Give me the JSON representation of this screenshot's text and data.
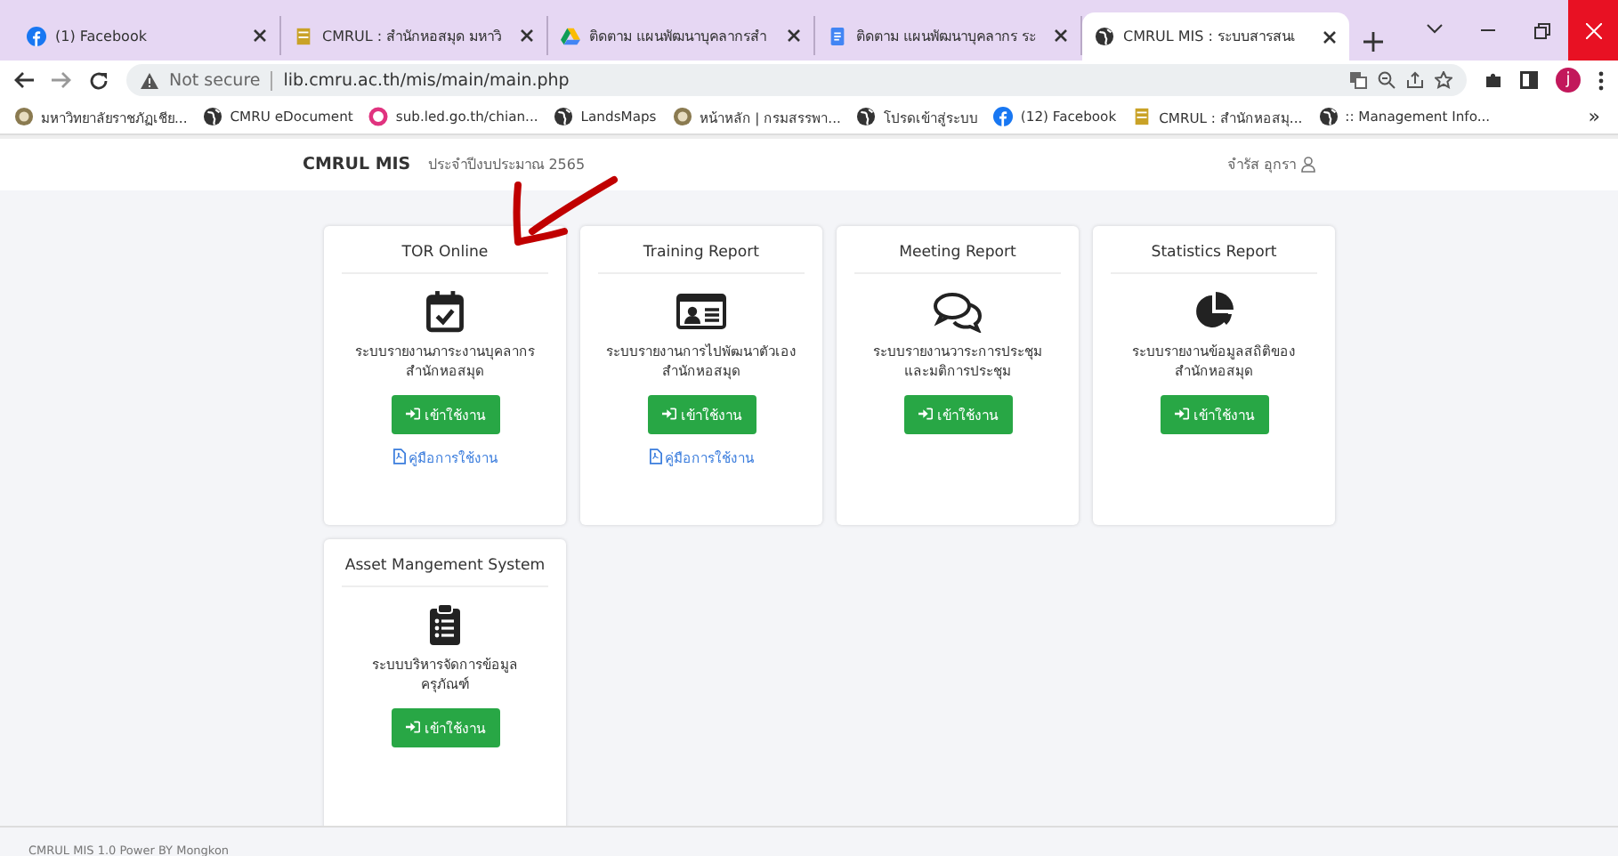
{
  "browser": {
    "tabs": [
      {
        "title": "(1) Facebook",
        "kind": "facebook",
        "selected": false
      },
      {
        "title": "CMRUL : สำนักหอสมุด มหาวิ",
        "kind": "book",
        "selected": false
      },
      {
        "title": "ติดตาม แผนพัฒนาบุคลากรสำ",
        "kind": "drive",
        "selected": false
      },
      {
        "title": "ติดตาม แผนพัฒนาบุคลากร ระ",
        "kind": "docs",
        "selected": false
      },
      {
        "title": "CMRUL MIS : ระบบสารสนเ",
        "kind": "globe",
        "selected": true
      }
    ],
    "security": "Not secure",
    "url": "lib.cmru.ac.th/mis/main/main.php",
    "avatar": "j",
    "bookmarks": [
      {
        "title": "มหาวิทยาลัยราชภัฏเชีย...",
        "kind": "seal"
      },
      {
        "title": "CMRU eDocument",
        "kind": "globe"
      },
      {
        "title": "sub.led.go.th/chian...",
        "kind": "pink"
      },
      {
        "title": "LandsMaps",
        "kind": "globe"
      },
      {
        "title": "หน้าหลัก | กรมสรรพา...",
        "kind": "seal"
      },
      {
        "title": "โปรดเข้าสู่ระบบ",
        "kind": "globe"
      },
      {
        "title": "(12) Facebook",
        "kind": "facebook"
      },
      {
        "title": "CMRUL : สำนักหอสมุ...",
        "kind": "book"
      },
      {
        "title": ":: Management Info...",
        "kind": "globe"
      }
    ],
    "more": "»"
  },
  "navbar": {
    "brand": "CMRUL MIS",
    "fiscal_year": "ประจำปีงบประมาณ 2565",
    "user": "จำรัส อุกรา"
  },
  "cards": [
    {
      "title": "TOR Online",
      "kind": "calendar-check",
      "description": "ระบบรายงานภาระงานบุคลากร สำนักหอสมุด",
      "button": "เข้าใช้งาน",
      "manual": "คู่มือการใช้งาน"
    },
    {
      "title": "Training Report",
      "kind": "id-card",
      "description": "ระบบรายงานการไปพัฒนาตัวเอง สำนักหอสมุด",
      "button": "เข้าใช้งาน",
      "manual": "คู่มือการใช้งาน"
    },
    {
      "title": "Meeting Report",
      "kind": "chat",
      "description": "ระบบรายงานวาระการประชุมและมติการประชุม",
      "button": "เข้าใช้งาน"
    },
    {
      "title": "Statistics Report",
      "kind": "pie",
      "description": "ระบบรายงานข้อมูลสถิติของสำนักหอสมุด",
      "button": "เข้าใช้งาน"
    },
    {
      "title": "Asset Mangement System",
      "kind": "clipboard",
      "description": "ระบบบริหารจัดการข้อมูลครุภัณฑ์",
      "button": "เข้าใช้งาน"
    }
  ],
  "footer": "CMRUL MIS 1.0 Power BY Mongkon"
}
